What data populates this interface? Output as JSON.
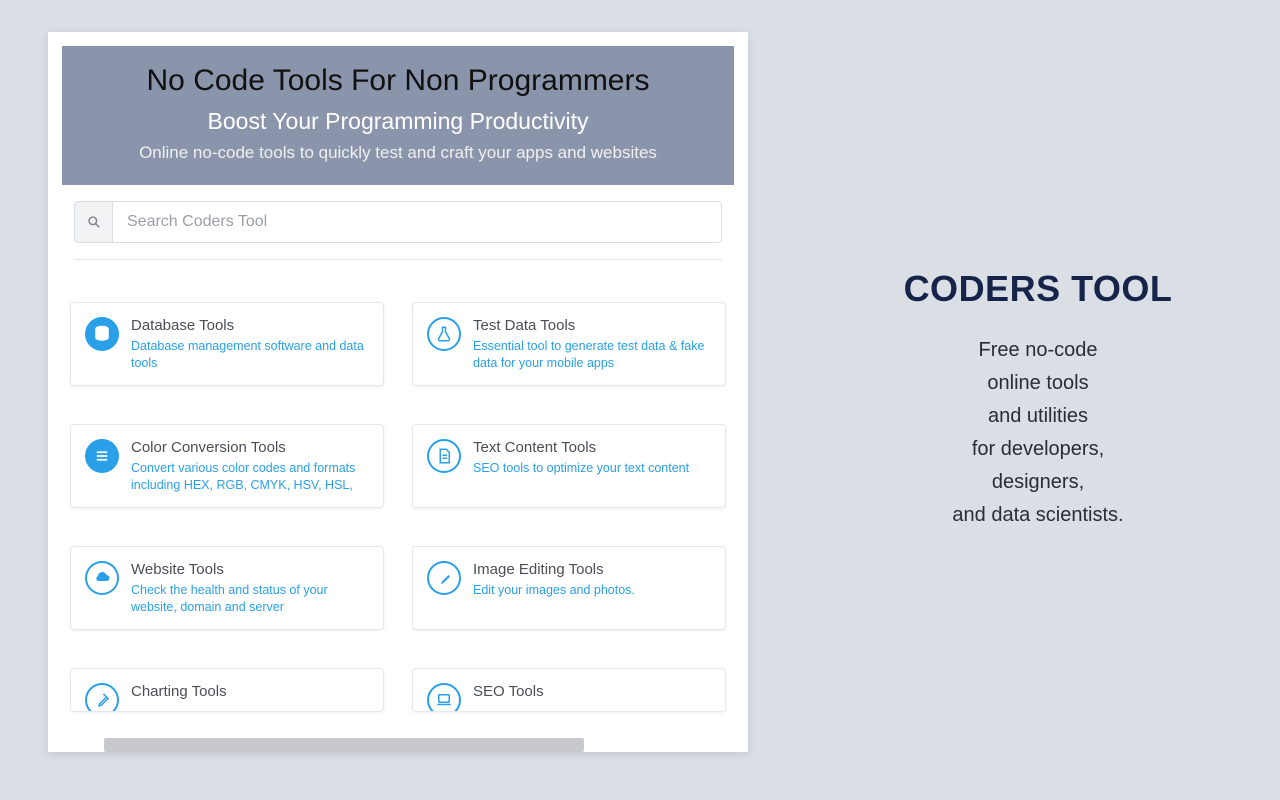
{
  "hero": {
    "title": "No Code Tools For Non Programmers",
    "subtitle": "Boost Your Programming Productivity",
    "desc": "Online no-code tools to quickly test and craft your apps and websites"
  },
  "search": {
    "placeholder": "Search Coders Tool"
  },
  "cards": [
    {
      "title": "Database Tools",
      "desc": "Database management software and data tools",
      "icon": "database",
      "filled": true
    },
    {
      "title": "Test Data Tools",
      "desc": "Essential tool to generate test data & fake data for your mobile apps",
      "icon": "flask",
      "filled": false
    },
    {
      "title": "Color Conversion Tools",
      "desc": "Convert various color codes and formats including HEX, RGB, CMYK, HSV, HSL,",
      "icon": "lines",
      "filled": true
    },
    {
      "title": "Text Content Tools",
      "desc": "SEO tools to optimize your text content",
      "icon": "document",
      "filled": false
    },
    {
      "title": "Website Tools",
      "desc": "Check the health and status of your website, domain and server",
      "icon": "cloud",
      "filled": false
    },
    {
      "title": "Image Editing Tools",
      "desc": "Edit your images and photos.",
      "icon": "brush",
      "filled": false
    },
    {
      "title": "Charting Tools",
      "desc": "",
      "icon": "brush",
      "filled": false
    },
    {
      "title": "SEO Tools",
      "desc": "",
      "icon": "laptop",
      "filled": false
    }
  ],
  "sidebar": {
    "title": "CODERS TOOL",
    "text": "Free no-code\nonline tools\nand utilities\nfor developers,\ndesigners,\nand data scientists."
  }
}
